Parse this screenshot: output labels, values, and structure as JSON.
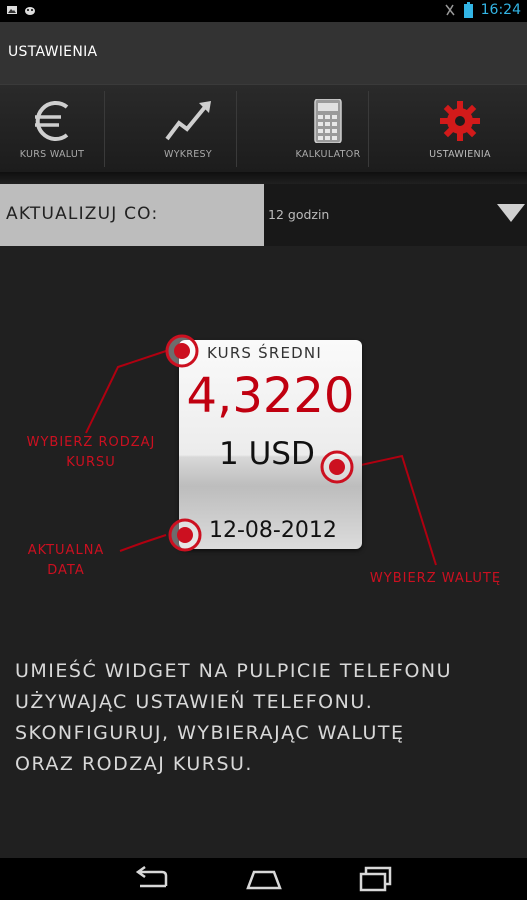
{
  "status_bar": {
    "time": "16:24"
  },
  "action_bar": {
    "title": "USTAWIENIA"
  },
  "tabs": [
    {
      "label": "KURS WALUT",
      "icon": "euro-icon",
      "selected": false
    },
    {
      "label": "WYKRESY",
      "icon": "chart-up-icon",
      "selected": false
    },
    {
      "label": "KALKULATOR",
      "icon": "calculator-icon",
      "selected": false
    },
    {
      "label": "USTAWIENIA",
      "icon": "gear-icon",
      "selected": true
    }
  ],
  "refresh": {
    "label": "AKTUALIZUJ CO:",
    "value": "12 godzin"
  },
  "widget_example": {
    "rate_type": "KURS ŚREDNI",
    "rate": "4,3220",
    "currency": "1 USD",
    "date": "12-08-2012"
  },
  "callouts": {
    "rate_type_line1": "WYBIERZ RODZAJ",
    "rate_type_line2": "KURSU",
    "date_line1": "AKTUALNA",
    "date_line2": "DATA",
    "currency": "WYBIERZ WALUTĘ"
  },
  "instructions": [
    "UMIEŚĆ WIDGET NA PULPICIE TELEFONU",
    "UŻYWAJĄC USTAWIEŃ TELEFONU.",
    "SKONFIGURUJ, WYBIERAJĄC WALUTĘ",
    "ORAZ RODZAJ KURSU."
  ],
  "colors": {
    "accent_red": "#cc1020",
    "status_blue": "#33b5e5"
  }
}
